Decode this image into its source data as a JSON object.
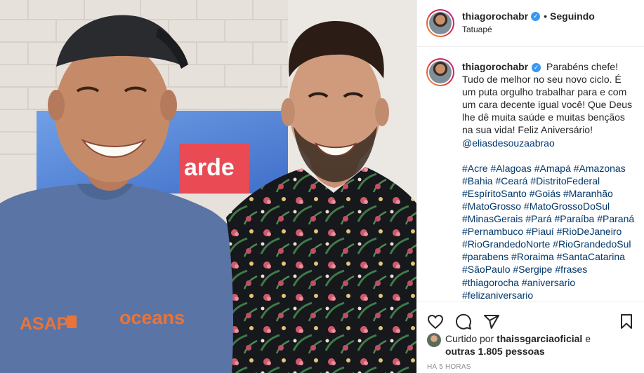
{
  "post": {
    "username": "thiagorochabr",
    "verified": true,
    "separator": "•",
    "follow_status": "Seguindo",
    "location": "Tatuapé"
  },
  "caption": {
    "username": "thiagorochabr",
    "text": "Parabéns chefe! Tudo de melhor no seu novo ciclo. É um puta orgulho trabalhar para e com um cara decente igual você! Que Deus lhe dê muita saúde e muitas bençãos na sua vida! Feliz Aniversário!",
    "mention": "@eliasdesouzaabrao",
    "hashtags": "#Acre #Alagoas #Amapá #Amazonas #Bahia #Ceará #DistritoFederal #EspíritoSanto #Goiás #Maranhão #MatoGrosso #MatoGrossoDoSul #MinasGerais #Pará #Paraíba #Paraná #Pernambuco #Piauí #RioDeJaneiro #RioGrandedoNorte #RioGrandedoSul #parabens #Roraima #SantaCatarina #SãoPaulo #Sergipe #frases #thiagorocha #aniversario #felizaniversario"
  },
  "likes": {
    "prefix": "Curtido por",
    "user": "thaissgarciaoficial",
    "connector": "e",
    "others": "outras 1.805 pessoas"
  },
  "timestamp": "HÁ 5 HORAS",
  "photo": {
    "shirt_left": "ASAP",
    "shirt_right": "oceans",
    "sign": "arde"
  },
  "icons": {
    "like": "heart-icon",
    "comment": "comment-icon",
    "share": "share-icon",
    "save": "bookmark-icon"
  },
  "colors": {
    "link": "#00376b",
    "verified": "#3897f0",
    "muted": "#8e8e8e",
    "text": "#262626"
  }
}
